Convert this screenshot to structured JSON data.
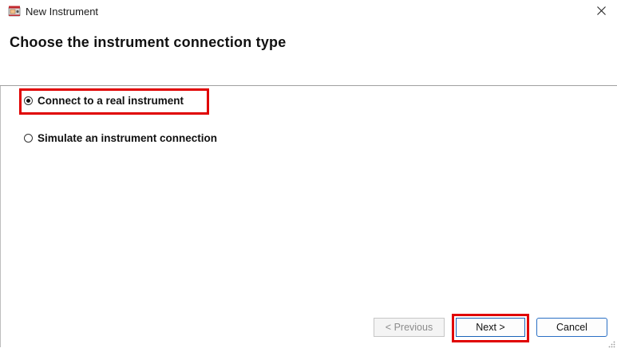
{
  "window": {
    "title": "New Instrument",
    "app_icon": "instrument-app-icon",
    "close_icon": "close-icon"
  },
  "header": {
    "title": "Choose the instrument connection type"
  },
  "options": [
    {
      "label": "Connect to a real instrument",
      "selected": true
    },
    {
      "label": "Simulate an instrument connection",
      "selected": false
    }
  ],
  "buttons": {
    "previous": {
      "label": "< Previous",
      "enabled": false
    },
    "next": {
      "label": "Next >",
      "enabled": true
    },
    "cancel": {
      "label": "Cancel",
      "enabled": true
    }
  },
  "colors": {
    "highlight": "#e00000",
    "focus_border": "#1a63b8",
    "divider": "#a0a0a0"
  }
}
